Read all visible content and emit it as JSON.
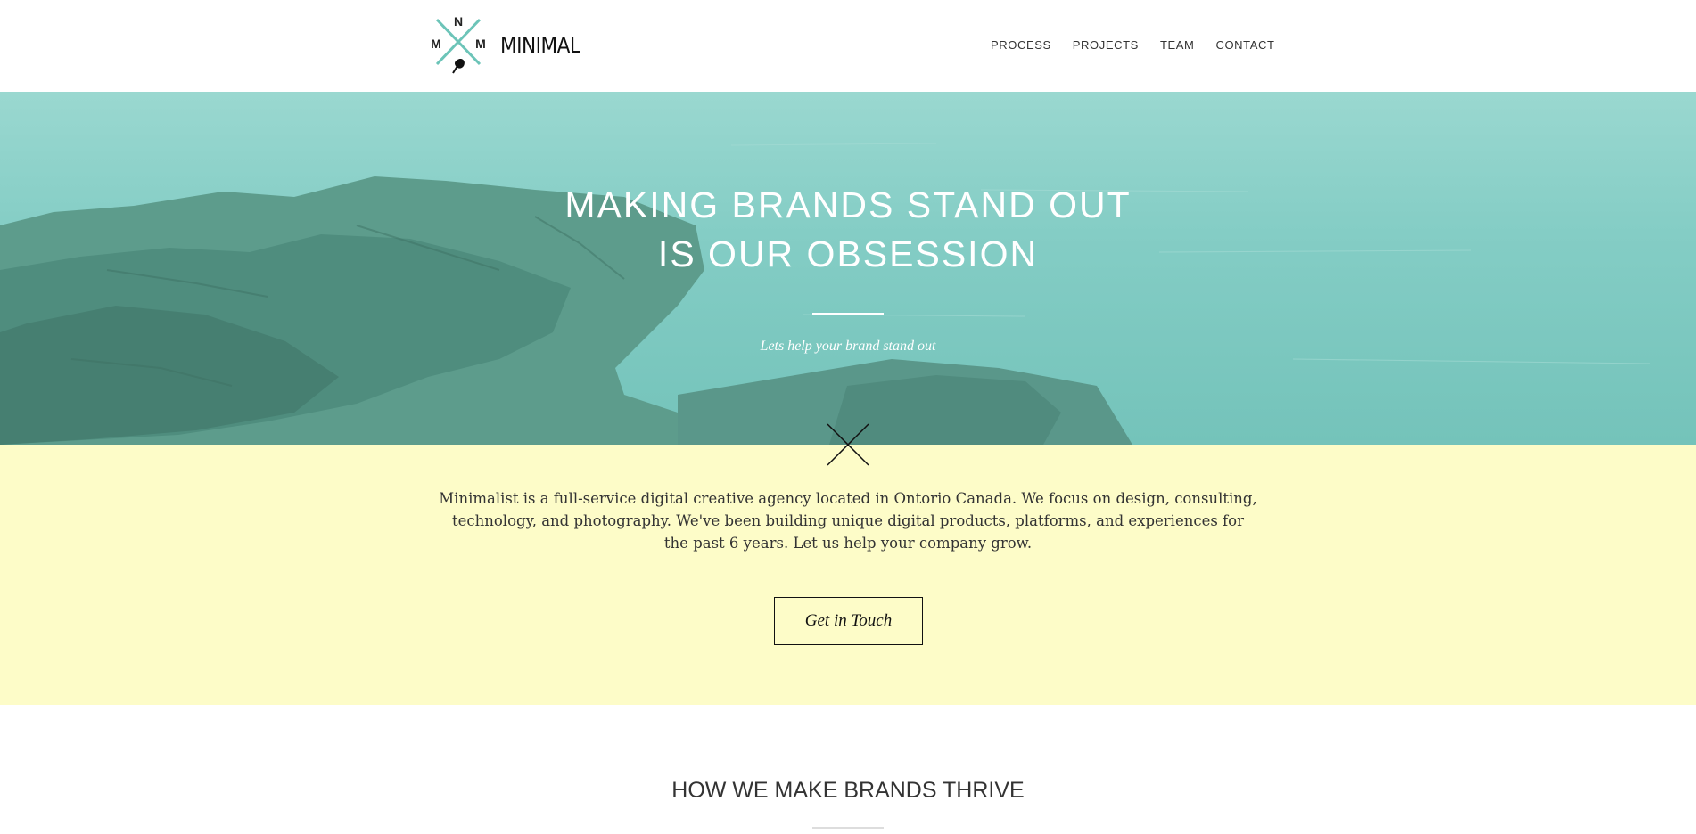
{
  "header": {
    "logo": {
      "letter_top": "N",
      "letter_left": "M",
      "letter_right": "M"
    },
    "brand_name": "MINIMAL",
    "nav": [
      {
        "label": "PROCESS"
      },
      {
        "label": "PROJECTS"
      },
      {
        "label": "TEAM"
      },
      {
        "label": "CONTACT"
      }
    ]
  },
  "hero": {
    "title_line1": "MAKING BRANDS STAND OUT",
    "title_line2": "IS OUR OBSESSION",
    "tagline": "Lets help your brand stand out",
    "overlay_color": "#84cdc5"
  },
  "intro": {
    "text": "Minimalist is a full-service digital creative agency located in Ontorio Canada. We focus on design, consulting, technology, and photography. We've been building unique digital products, platforms, and experiences for the past 6 years. Let us help your company grow.",
    "cta_label": "Get in Touch",
    "background_color": "#fdfcc8"
  },
  "section": {
    "title": "HOW WE MAKE BRANDS THRIVE"
  },
  "icons": [
    "logo-cross-icon",
    "leaf-icon",
    "x-mark-icon"
  ]
}
